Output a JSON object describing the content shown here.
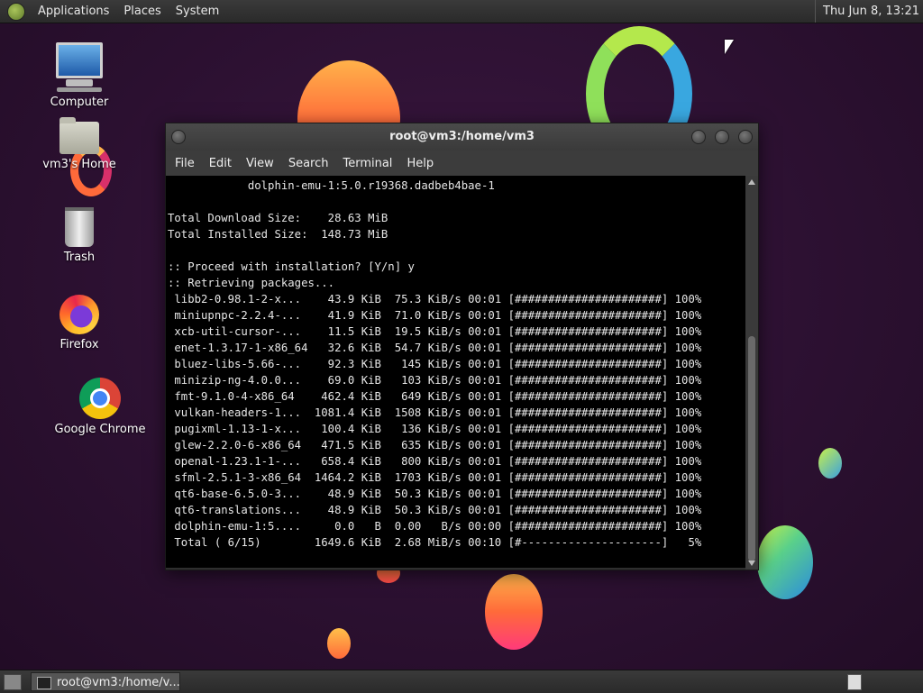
{
  "top_panel": {
    "menus": [
      "Applications",
      "Places",
      "System"
    ],
    "clock": "Thu Jun  8, 13:21"
  },
  "desktop_icons": [
    {
      "label": "Computer",
      "icon": "computer-icon"
    },
    {
      "label": "vm3's Home",
      "icon": "home-folder-icon"
    },
    {
      "label": "Trash",
      "icon": "trash-icon"
    },
    {
      "label": "Firefox",
      "icon": "firefox-icon"
    },
    {
      "label": "Google Chrome",
      "icon": "chrome-icon"
    }
  ],
  "window": {
    "title": "root@vm3:/home/vm3",
    "menu": [
      "File",
      "Edit",
      "View",
      "Search",
      "Terminal",
      "Help"
    ]
  },
  "terminal_lines": [
    "            dolphin-emu-1:5.0.r19368.dadbeb4bae-1",
    "",
    "Total Download Size:    28.63 MiB",
    "Total Installed Size:  148.73 MiB",
    "",
    ":: Proceed with installation? [Y/n] y",
    ":: Retrieving packages...",
    " libb2-0.98.1-2-x...    43.9 KiB  75.3 KiB/s 00:01 [######################] 100%",
    " miniupnpc-2.2.4-...    41.9 KiB  71.0 KiB/s 00:01 [######################] 100%",
    " xcb-util-cursor-...    11.5 KiB  19.5 KiB/s 00:01 [######################] 100%",
    " enet-1.3.17-1-x86_64   32.6 KiB  54.7 KiB/s 00:01 [######################] 100%",
    " bluez-libs-5.66-...    92.3 KiB   145 KiB/s 00:01 [######################] 100%",
    " minizip-ng-4.0.0...    69.0 KiB   103 KiB/s 00:01 [######################] 100%",
    " fmt-9.1.0-4-x86_64    462.4 KiB   649 KiB/s 00:01 [######################] 100%",
    " vulkan-headers-1...  1081.4 KiB  1508 KiB/s 00:01 [######################] 100%",
    " pugixml-1.13-1-x...   100.4 KiB   136 KiB/s 00:01 [######################] 100%",
    " glew-2.2.0-6-x86_64   471.5 KiB   635 KiB/s 00:01 [######################] 100%",
    " openal-1.23.1-1-...   658.4 KiB   800 KiB/s 00:01 [######################] 100%",
    " sfml-2.5.1-3-x86_64  1464.2 KiB  1703 KiB/s 00:01 [######################] 100%",
    " qt6-base-6.5.0-3...    48.9 KiB  50.3 KiB/s 00:01 [######################] 100%",
    " qt6-translations...    48.9 KiB  50.3 KiB/s 00:01 [######################] 100%",
    " dolphin-emu-1:5....     0.0   B  0.00   B/s 00:00 [######################] 100%",
    " Total ( 6/15)        1649.6 KiB  2.68 MiB/s 00:10 [#---------------------]   5%"
  ],
  "taskbar": {
    "task_label": "root@vm3:/home/v..."
  }
}
